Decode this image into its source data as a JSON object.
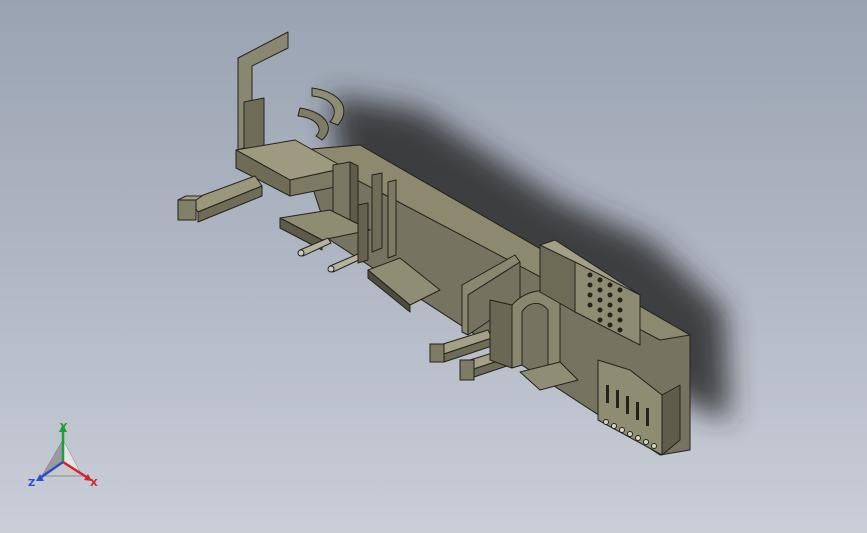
{
  "viewport": {
    "background_top": "#9aa3b2",
    "background_bottom": "#c9ced7",
    "model_color": "#7f7c66",
    "model_edge_color": "#23231b"
  },
  "triad": {
    "x_label": "X",
    "y_label": "Y",
    "z_label": "Z",
    "x_color": "#d2232a",
    "y_color": "#1f9e3a",
    "z_color": "#2b4fc7",
    "icon": "axis-triad-icon"
  }
}
